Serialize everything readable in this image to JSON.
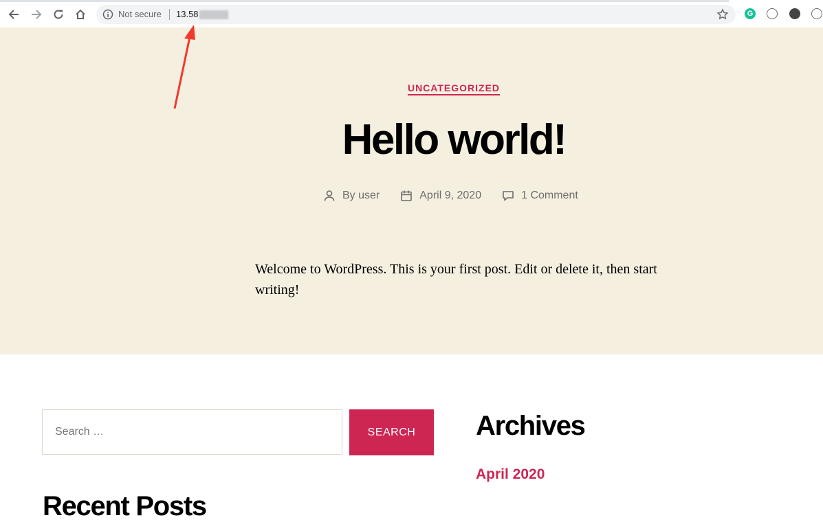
{
  "browser": {
    "security_label": "Not secure",
    "url": "13.58",
    "extensions": [
      "grammarly-icon",
      "extension-icon",
      "extension-dark-icon",
      "extension-icon"
    ],
    "grammarly_letter": "G"
  },
  "post": {
    "category": "UNCATEGORIZED",
    "title": "Hello world!",
    "author": "By user",
    "date": "April 9, 2020",
    "comments": "1 Comment",
    "body": "Welcome to WordPress. This is your first post. Edit or delete it, then start writing!"
  },
  "search": {
    "placeholder": "Search …",
    "button_label": "SEARCH"
  },
  "widgets": {
    "archives_title": "Archives",
    "archive_items": [
      "April 2020"
    ],
    "recent_posts_title": "Recent Posts"
  },
  "colors": {
    "accent": "#cd2653",
    "hero_bg": "#f5efe0",
    "meta_text": "#6d6d6d",
    "annotation_arrow": "#f03a2a"
  }
}
